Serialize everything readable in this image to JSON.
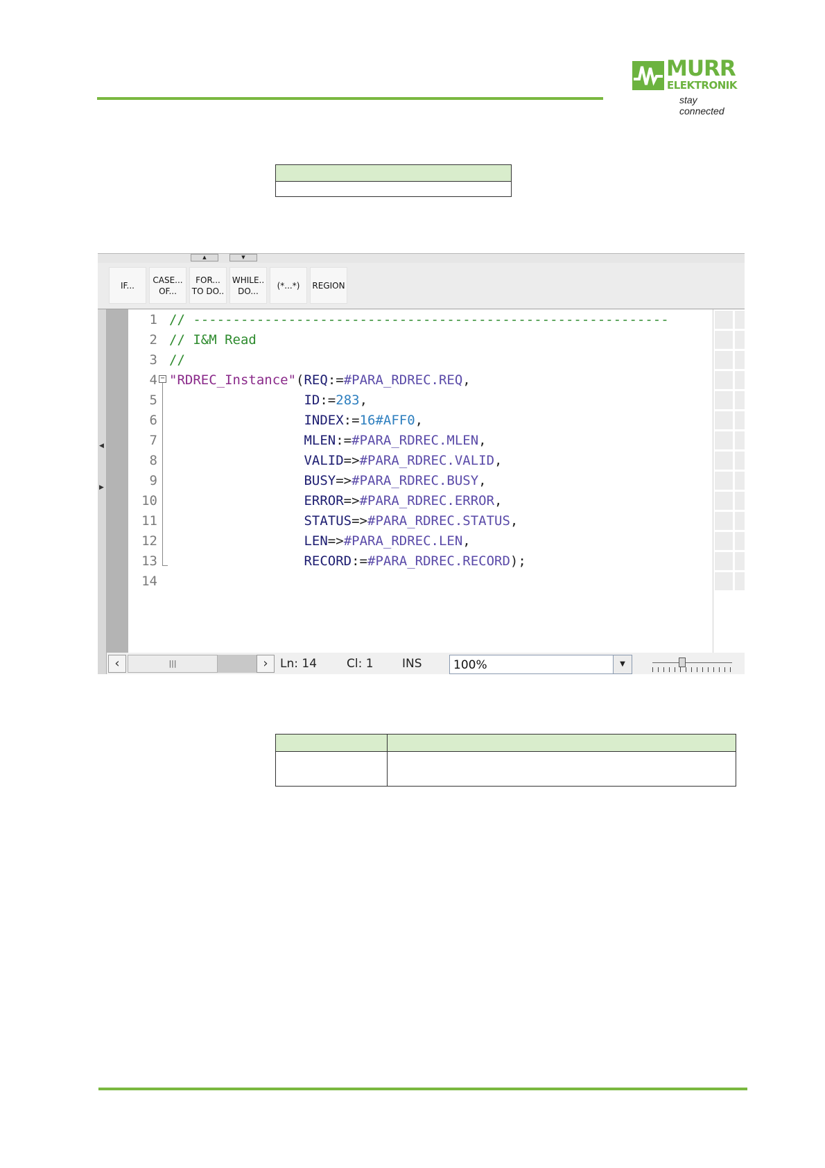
{
  "brand": {
    "name": "MURR",
    "sub": "ELEKTRONIK",
    "tagline": "stay connected",
    "color": "#6cb33f"
  },
  "editor": {
    "toolbar": [
      {
        "line1": "IF...",
        "line2": ""
      },
      {
        "line1": "CASE...",
        "line2": "OF..."
      },
      {
        "line1": "FOR...",
        "line2": "TO DO.."
      },
      {
        "line1": "WHILE..",
        "line2": "DO..."
      },
      {
        "line1": "(*...*)",
        "line2": ""
      },
      {
        "line1": "REGION",
        "line2": ""
      }
    ],
    "lines": [
      {
        "num": "1",
        "segments": [
          {
            "t": "// ------------------------------------------------------------",
            "c": "c-com"
          }
        ]
      },
      {
        "num": "2",
        "segments": [
          {
            "t": "// I&M Read",
            "c": "c-com"
          }
        ]
      },
      {
        "num": "3",
        "segments": [
          {
            "t": "//",
            "c": "c-com"
          }
        ]
      },
      {
        "num": "4",
        "segments": [
          {
            "t": "\"RDREC_Instance\"",
            "c": "c-str"
          },
          {
            "t": "(",
            "c": "c-op"
          },
          {
            "t": "REQ",
            "c": "c-par"
          },
          {
            "t": ":=",
            "c": "c-op"
          },
          {
            "t": "#PARA_RDREC.REQ",
            "c": "c-var"
          },
          {
            "t": ",",
            "c": "c-op"
          }
        ]
      },
      {
        "num": "5",
        "segments": [
          {
            "t": "                 ",
            "c": "c-op"
          },
          {
            "t": "ID",
            "c": "c-par"
          },
          {
            "t": ":=",
            "c": "c-op"
          },
          {
            "t": "283",
            "c": "c-num"
          },
          {
            "t": ",",
            "c": "c-op"
          }
        ]
      },
      {
        "num": "6",
        "segments": [
          {
            "t": "                 ",
            "c": "c-op"
          },
          {
            "t": "INDEX",
            "c": "c-par"
          },
          {
            "t": ":=",
            "c": "c-op"
          },
          {
            "t": "16#AFF0",
            "c": "c-num"
          },
          {
            "t": ",",
            "c": "c-op"
          }
        ]
      },
      {
        "num": "7",
        "segments": [
          {
            "t": "                 ",
            "c": "c-op"
          },
          {
            "t": "MLEN",
            "c": "c-par"
          },
          {
            "t": ":=",
            "c": "c-op"
          },
          {
            "t": "#PARA_RDREC.MLEN",
            "c": "c-var"
          },
          {
            "t": ",",
            "c": "c-op"
          }
        ]
      },
      {
        "num": "8",
        "segments": [
          {
            "t": "                 ",
            "c": "c-op"
          },
          {
            "t": "VALID",
            "c": "c-par"
          },
          {
            "t": "=>",
            "c": "c-op"
          },
          {
            "t": "#PARA_RDREC.VALID",
            "c": "c-var"
          },
          {
            "t": ",",
            "c": "c-op"
          }
        ]
      },
      {
        "num": "9",
        "segments": [
          {
            "t": "                 ",
            "c": "c-op"
          },
          {
            "t": "BUSY",
            "c": "c-par"
          },
          {
            "t": "=>",
            "c": "c-op"
          },
          {
            "t": "#PARA_RDREC.BUSY",
            "c": "c-var"
          },
          {
            "t": ",",
            "c": "c-op"
          }
        ]
      },
      {
        "num": "10",
        "segments": [
          {
            "t": "                 ",
            "c": "c-op"
          },
          {
            "t": "ERROR",
            "c": "c-par"
          },
          {
            "t": "=>",
            "c": "c-op"
          },
          {
            "t": "#PARA_RDREC.ERROR",
            "c": "c-var"
          },
          {
            "t": ",",
            "c": "c-op"
          }
        ]
      },
      {
        "num": "11",
        "segments": [
          {
            "t": "                 ",
            "c": "c-op"
          },
          {
            "t": "STATUS",
            "c": "c-par"
          },
          {
            "t": "=>",
            "c": "c-op"
          },
          {
            "t": "#PARA_RDREC.STATUS",
            "c": "c-var"
          },
          {
            "t": ",",
            "c": "c-op"
          }
        ]
      },
      {
        "num": "12",
        "segments": [
          {
            "t": "                 ",
            "c": "c-op"
          },
          {
            "t": "LEN",
            "c": "c-par"
          },
          {
            "t": "=>",
            "c": "c-op"
          },
          {
            "t": "#PARA_RDREC.LEN",
            "c": "c-var"
          },
          {
            "t": ",",
            "c": "c-op"
          }
        ]
      },
      {
        "num": "13",
        "segments": [
          {
            "t": "                 ",
            "c": "c-op"
          },
          {
            "t": "RECORD",
            "c": "c-par"
          },
          {
            "t": ":=",
            "c": "c-op"
          },
          {
            "t": "#PARA_RDREC.RECORD",
            "c": "c-var"
          },
          {
            "t": ");",
            "c": "c-op"
          }
        ]
      },
      {
        "num": "14",
        "segments": []
      }
    ],
    "status": {
      "ln": "Ln: 14",
      "cl": "Cl: 1",
      "mode": "INS",
      "zoom": "100%",
      "thumb_grip": "|||"
    }
  }
}
